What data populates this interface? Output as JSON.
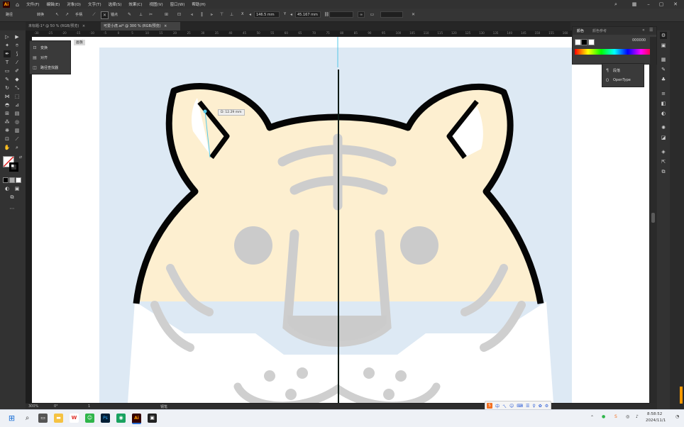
{
  "app": {
    "logo_text": "Ai",
    "home_icon": "home-icon"
  },
  "menu": {
    "items": [
      "文件(F)",
      "编辑(E)",
      "对象(O)",
      "文字(T)",
      "选择(S)",
      "效果(C)",
      "视图(V)",
      "窗口(W)",
      "帮助(H)"
    ]
  },
  "control_bar": {
    "path_label": "路径",
    "stroke_label": "描边",
    "convert_label": "转换",
    "handle_label": "手柄",
    "anchor_label": "锚点",
    "x_value": "146.5 mm",
    "y_value": "45.167 mm",
    "x_prefix": "X",
    "y_prefix": "Y"
  },
  "tabs": [
    {
      "label": "未标题-1* @ 50 % (RGB/预览)",
      "close": "×"
    },
    {
      "label": "可爱小虎.ai* @ 300 % (RGB/预览)",
      "close": "×"
    }
  ],
  "ruler": {
    "numbers": [
      "-30",
      "-25",
      "-20",
      "-15",
      "-10",
      "-5",
      "0",
      "5",
      "10",
      "15",
      "20",
      "25",
      "30",
      "35",
      "40",
      "45",
      "50",
      "55",
      "60",
      "65",
      "70",
      "75",
      "80",
      "85",
      "90",
      "95",
      "100",
      "105",
      "110",
      "115",
      "120",
      "125",
      "130",
      "135",
      "140",
      "145",
      "150",
      "155",
      "160",
      "165",
      "170",
      "175",
      "180",
      "185"
    ]
  },
  "artboard": {
    "label": "画板"
  },
  "left_panel": {
    "items": [
      {
        "label": "变换",
        "icon": "transform-icon"
      },
      {
        "label": "对齐",
        "icon": "align-icon"
      },
      {
        "label": "路径查找器",
        "icon": "pathfinder-icon"
      }
    ]
  },
  "color_panel": {
    "tab_color": "颜色",
    "tab_guide": "颜色参考",
    "hex_value": "000000"
  },
  "char_panel": {
    "items": [
      {
        "label": "段落",
        "icon": "paragraph-icon"
      },
      {
        "label": "OpenType",
        "icon": "opentype-icon"
      }
    ]
  },
  "measure_tooltip": {
    "text": "D: 12.29 mm"
  },
  "status": {
    "zoom": "300%",
    "angle": "0°",
    "page": "1",
    "tool_name": "钢笔"
  },
  "taskbar": {
    "time": "8:58:52",
    "date": "2024/11/1",
    "icons": [
      "start-icon",
      "search-icon",
      "taskview-icon",
      "file-explorer-icon",
      "wps-icon",
      "wechat-icon",
      "photoshop-icon",
      "browser-icon",
      "illustrator-icon",
      "media-icon"
    ]
  },
  "ime_bar": {
    "items": [
      "S",
      "中",
      "ㄟ",
      "☺",
      "⌨",
      "☰",
      "♀",
      "✿",
      "⚙"
    ]
  },
  "colors": {
    "accent": "#ff9a00",
    "canvas_bg": "#ffffff",
    "artwork_bg": "#dde9f4",
    "tiger_face": "#fdefd0",
    "tiger_stripe": "#c8c8c8",
    "outline": "#050505",
    "guide": "#53c8e8"
  }
}
